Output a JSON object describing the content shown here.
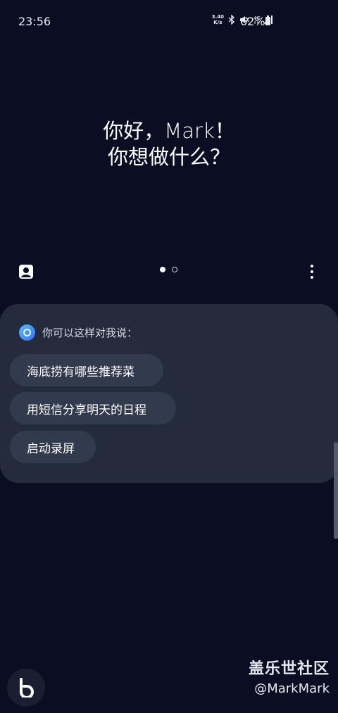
{
  "status": {
    "time": "23:56",
    "speed_top": "3.40",
    "speed_bottom": "K/s",
    "battery": "62%"
  },
  "greeting": {
    "line1": "你好，Mark！",
    "line2": "你想做什么？"
  },
  "pager": {
    "active_index": 0,
    "count": 2
  },
  "suggestions": {
    "title": "你可以这样对我说：",
    "items": [
      "海底捞有哪些推荐菜",
      "用短信分享明天的日程",
      "启动录屏"
    ]
  },
  "watermark": {
    "title": "盖乐世社区",
    "user": "@MarkMark"
  },
  "colors": {
    "background": "#0b0e22",
    "card": "#242b3d",
    "chip": "#323a4e",
    "accent": "#3a8fff"
  }
}
